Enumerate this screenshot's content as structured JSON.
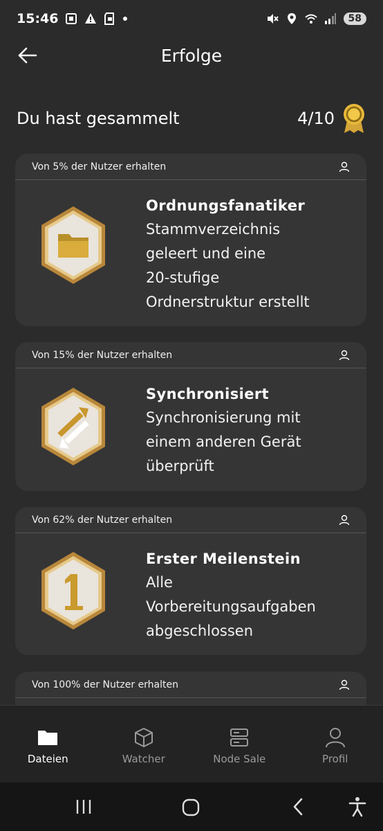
{
  "status_bar": {
    "time": "15:46",
    "battery": "58",
    "left_icons": [
      "screenshot-icon",
      "warning-icon",
      "sd-card-icon",
      "notification-dot"
    ],
    "right_icons": [
      "mute-icon",
      "location-icon",
      "wifi-icon",
      "signal-icon"
    ]
  },
  "header": {
    "title": "Erfolge",
    "back_icon": "arrow-left-icon"
  },
  "summary": {
    "label": "Du hast gesammelt",
    "count": "4/10",
    "icon": "gold-medal-icon"
  },
  "achievements": [
    {
      "meta": "Von 5% der Nutzer erhalten",
      "title": "Ordnungsfanatiker",
      "description_lines": [
        "Stammverzeichnis",
        "geleert und eine",
        "20-stufige",
        "Ordnerstruktur erstellt"
      ],
      "badge_icon": "folder-badge-icon"
    },
    {
      "meta": "Von 15% der Nutzer erhalten",
      "title": "Synchronisiert",
      "description_lines": [
        "Synchronisierung mit",
        "einem anderen Gerät",
        "überprüft"
      ],
      "badge_icon": "sync-arrows-badge-icon"
    },
    {
      "meta": "Von 62% der Nutzer erhalten",
      "title": "Erster Meilenstein",
      "description_lines": [
        "Alle",
        "Vorbereitungsaufgaben",
        "abgeschlossen"
      ],
      "badge_icon": "number-one-badge-icon"
    },
    {
      "meta": "Von 100% der Nutzer erhalten"
    }
  ],
  "bottom_nav": [
    {
      "label": "Dateien",
      "icon": "folder-icon",
      "active": true
    },
    {
      "label": "Watcher",
      "icon": "cube-icon",
      "active": false
    },
    {
      "label": "Node Sale",
      "icon": "server-icon",
      "active": false
    },
    {
      "label": "Profil",
      "icon": "user-icon",
      "active": false
    }
  ],
  "colors": {
    "background": "#2b2b2b",
    "card": "#353535",
    "nav_background": "#232323",
    "gold": "#d4a537",
    "inactive": "#9a9a9a"
  }
}
